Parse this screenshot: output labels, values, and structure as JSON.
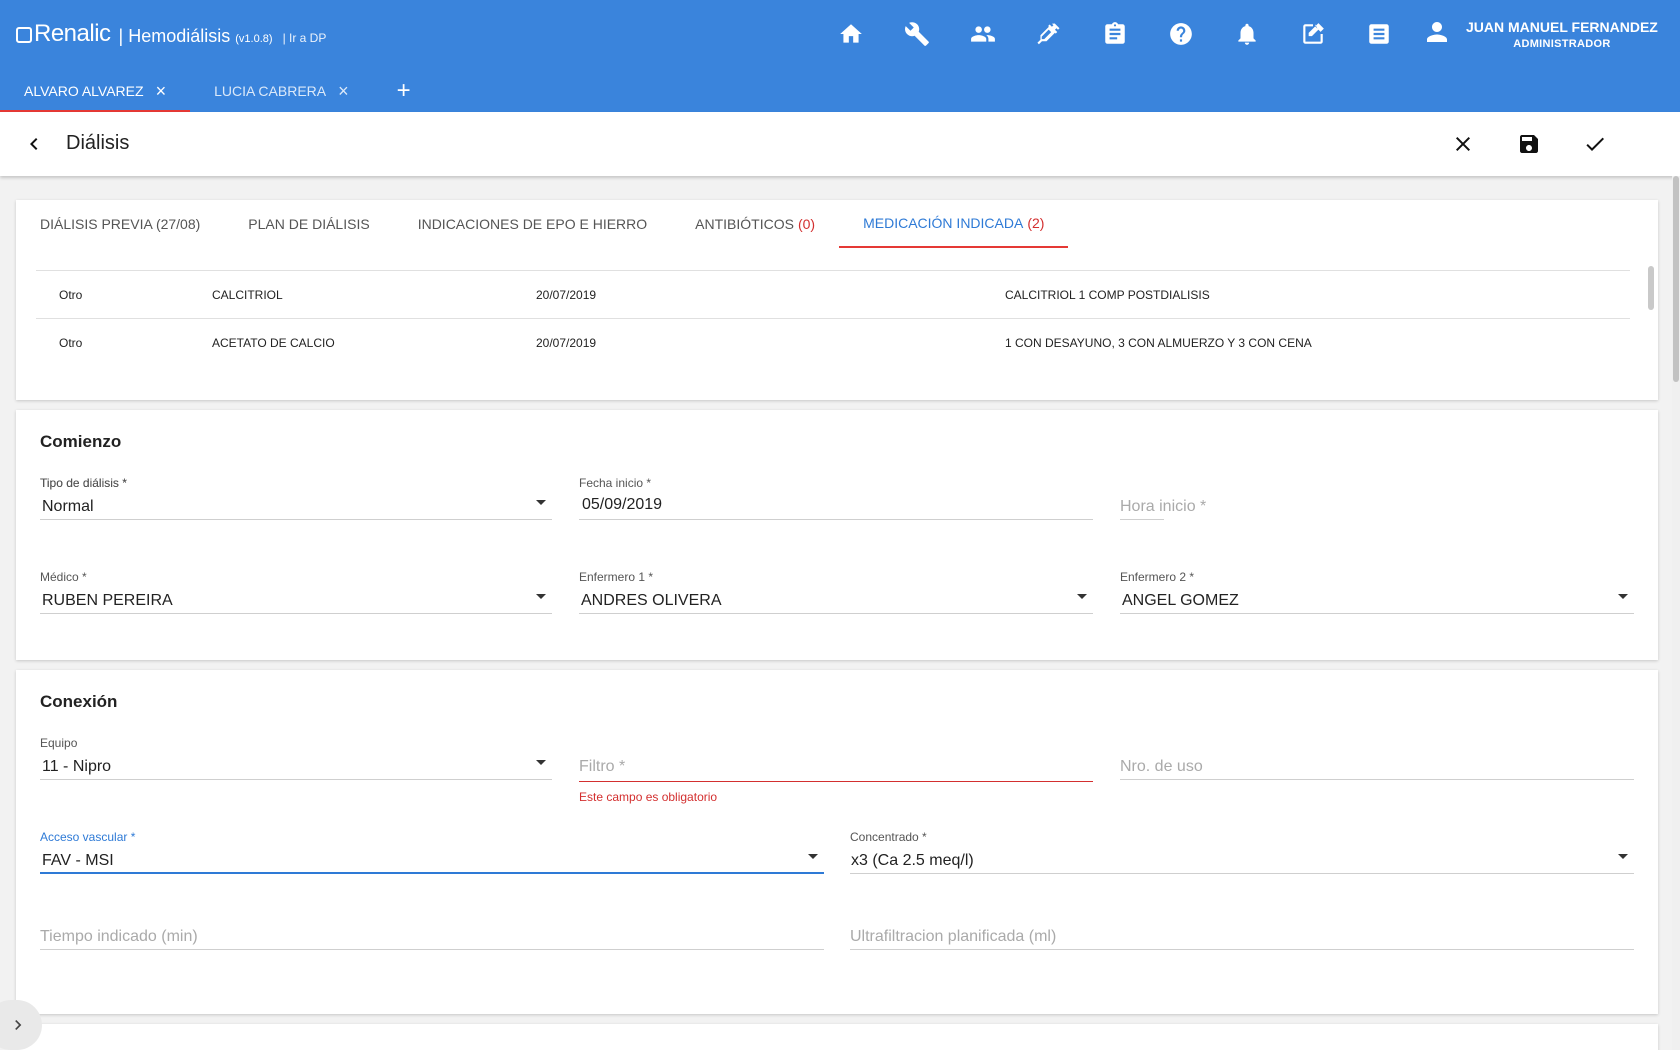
{
  "app": {
    "logo_text": "Renalic",
    "app_name": "| Hemodiálisis",
    "version": "(v1.0.8)",
    "goto_dp": "| Ir a DP"
  },
  "toolbar_icons": [
    "home-icon",
    "wrench-icon",
    "people-icon",
    "syringe-icon",
    "clipboard-icon",
    "help-icon",
    "bell-icon",
    "edit-icon",
    "list-icon"
  ],
  "user": {
    "name": "JUAN MANUEL FERNANDEZ",
    "role": "ADMINISTRADOR"
  },
  "patient_tabs": [
    {
      "label": "ALVARO ALVAREZ",
      "active": true
    },
    {
      "label": "LUCIA CABRERA",
      "active": false
    }
  ],
  "add_tab_label": "+",
  "page": {
    "title": "Diálisis"
  },
  "tabs": [
    {
      "label": "DIÁLISIS PREVIA (27/08)",
      "count": ""
    },
    {
      "label": "PLAN DE DIÁLISIS",
      "count": ""
    },
    {
      "label": "INDICACIONES DE EPO E HIERRO",
      "count": ""
    },
    {
      "label": "ANTIBIÓTICOS",
      "count": "(0)"
    },
    {
      "label": "MEDICACIÓN INDICADA",
      "count": "(2)",
      "active": true
    }
  ],
  "medication_rows": [
    {
      "tipo": "Otro",
      "medicamento": "CALCITRIOL",
      "fecha": "20/07/2019",
      "indicacion": "CALCITRIOL 1 COMP POSTDIALISIS"
    },
    {
      "tipo": "Otro",
      "medicamento": "ACETATO DE CALCIO",
      "fecha": "20/07/2019",
      "indicacion": "1 CON DESAYUNO, 3 CON ALMUERZO Y 3 CON CENA"
    }
  ],
  "comienzo": {
    "title": "Comienzo",
    "tipo_dialisis": {
      "label": "Tipo de diálisis *",
      "value": "Normal"
    },
    "fecha_inicio": {
      "label": "Fecha inicio *",
      "value": "05/09/2019"
    },
    "hora_inicio": {
      "placeholder": "Hora inicio *"
    },
    "medico": {
      "label": "Médico *",
      "value": "RUBEN PEREIRA"
    },
    "enfermero1": {
      "label": "Enfermero 1 *",
      "value": "ANDRES OLIVERA"
    },
    "enfermero2": {
      "label": "Enfermero 2 *",
      "value": "ANGEL GOMEZ"
    }
  },
  "conexion": {
    "title": "Conexión",
    "equipo": {
      "label": "Equipo",
      "value": "11 - Nipro"
    },
    "filtro": {
      "placeholder": "Filtro *",
      "error": "Este campo es obligatorio"
    },
    "nro_uso": {
      "placeholder": "Nro. de uso"
    },
    "acceso_vascular": {
      "label": "Acceso vascular *",
      "value": "FAV - MSI"
    },
    "concentrado": {
      "label": "Concentrado *",
      "value": "x3 (Ca 2.5 meq/l)"
    },
    "tiempo_indicado": {
      "placeholder": "Tiempo indicado (min)"
    },
    "ultrafiltracion": {
      "placeholder": "Ultrafiltracion planificada (ml)"
    }
  },
  "colors": {
    "primary": "#3a84dc",
    "accent_red": "#e53935",
    "error": "#d32f2f",
    "active_tab": "#2e7ad6"
  }
}
